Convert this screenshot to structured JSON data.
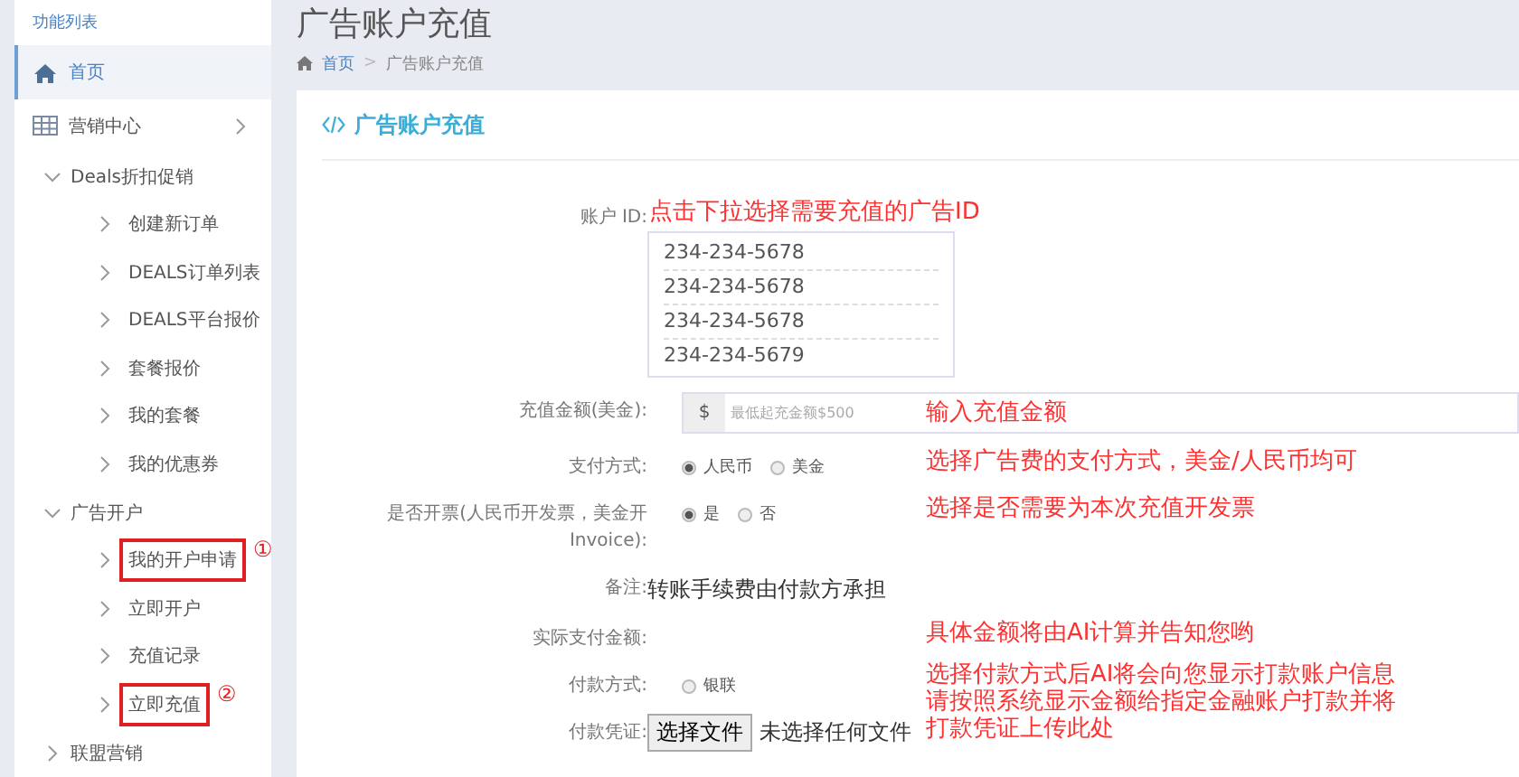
{
  "sidebar": {
    "heading": "功能列表",
    "items": [
      {
        "kind": "home",
        "label": "首页",
        "selected": true
      },
      {
        "kind": "menu",
        "label": "营销中心",
        "selected": false
      },
      {
        "kind": "group",
        "label": "Deals折扣促销",
        "expanded": true,
        "children": [
          {
            "label": "创建新订单",
            "highlighted": false
          },
          {
            "label": "DEALS订单列表",
            "highlighted": false
          },
          {
            "label": "DEALS平台报价",
            "highlighted": false
          },
          {
            "label": "套餐报价",
            "highlighted": false
          },
          {
            "label": "我的套餐",
            "highlighted": false
          },
          {
            "label": "我的优惠券",
            "highlighted": false
          }
        ]
      },
      {
        "kind": "group",
        "label": "广告开户",
        "expanded": true,
        "children": [
          {
            "label": "我的开户申请",
            "highlighted": true,
            "marker": "①"
          },
          {
            "label": "立即开户",
            "highlighted": false
          },
          {
            "label": "充值记录",
            "highlighted": false
          },
          {
            "label": "立即充值",
            "highlighted": true,
            "marker": "②"
          }
        ]
      },
      {
        "kind": "group",
        "label": "联盟营销",
        "expanded": false
      }
    ]
  },
  "page": {
    "title": "广告账户充值",
    "breadcrumb": [
      "首页",
      "广告账户充值"
    ],
    "separator": ">"
  },
  "card": {
    "title": "广告账户充值",
    "fields": [
      {
        "kind": "account_list",
        "label": "账户 ID:",
        "hint": "点击下拉选择需要充值的广告ID",
        "options": [
          "234-234-5678",
          "234-234-5678",
          "234-234-5678",
          "234-234-5679"
        ]
      },
      {
        "kind": "amount",
        "label": "充值金额(美金):",
        "prefix": "$",
        "placeholder": "最低起充金额$500",
        "hint": "输入充值金额"
      },
      {
        "kind": "radio",
        "label": "支付方式:",
        "options": [
          {
            "label": "人民币",
            "selected": true
          },
          {
            "label": "美金",
            "selected": false
          }
        ],
        "hint": "选择广告费的支付方式，美金/人民币均可"
      },
      {
        "kind": "radio",
        "label": "是否开票(人民币开发票，美金开Invoice):",
        "options": [
          {
            "label": "是",
            "selected": true
          },
          {
            "label": "否",
            "selected": false
          }
        ],
        "hint": "选择是否需要为本次充值开发票"
      },
      {
        "kind": "text",
        "label": "备注:",
        "value": "转账手续费由付款方承担"
      },
      {
        "kind": "empty",
        "label": "实际支付金额:",
        "hint": "具体金额将由AI计算并告知您哟"
      },
      {
        "kind": "radio",
        "label": "付款方式:",
        "options": [
          {
            "label": "银联",
            "selected": false
          }
        ],
        "hint": [
          "选择付款方式后AI将会向您显示打款账户信息",
          "请按照系统显示金额给指定金融账户打款并将",
          "打款凭证上传此处"
        ]
      },
      {
        "kind": "file",
        "label": "付款凭证:",
        "button": "选择文件",
        "status": "未选择任何文件"
      }
    ]
  }
}
